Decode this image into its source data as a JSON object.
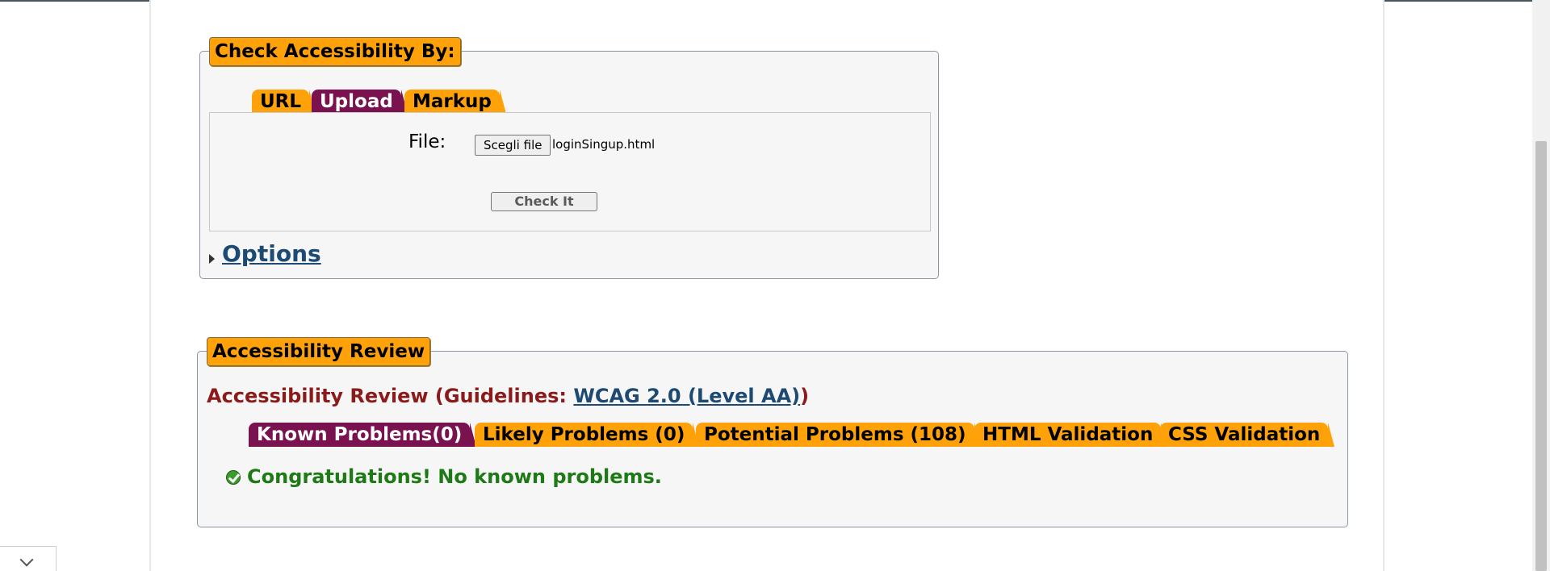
{
  "check_section": {
    "legend": "Check Accessibility By:",
    "tabs": [
      {
        "label": "URL",
        "active": false
      },
      {
        "label": "Upload",
        "active": true
      },
      {
        "label": "Markup",
        "active": false
      }
    ],
    "file_label": "File:",
    "choose_file_label": "Scegli file",
    "file_name": "loginSingup.html",
    "check_button": "Check It",
    "options_link": "Options"
  },
  "review_section": {
    "legend": "Accessibility Review",
    "heading_prefix": "Accessibility Review (Guidelines: ",
    "guideline_link": "WCAG 2.0 (Level AA)",
    "heading_suffix": ")",
    "tabs": [
      {
        "label": "Known Problems(0)",
        "active": true
      },
      {
        "label": "Likely Problems (0)",
        "active": false
      },
      {
        "label": "Potential Problems (108)",
        "active": false
      },
      {
        "label": "HTML Validation",
        "active": false
      },
      {
        "label": "CSS Validation",
        "active": false
      }
    ],
    "message": "Congratulations! No known problems."
  },
  "colors": {
    "tab_orange": "#ffa20a",
    "tab_active": "#7a1250",
    "heading_red": "#8b1a1a",
    "link_blue": "#1c4a72",
    "success_green": "#1d7a16"
  }
}
